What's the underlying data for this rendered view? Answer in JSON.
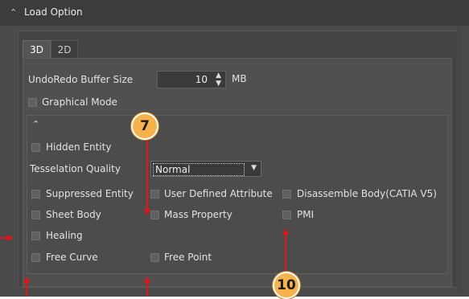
{
  "section": {
    "title": "Load Option"
  },
  "tabs": [
    {
      "label": "3D"
    },
    {
      "label": "2D"
    }
  ],
  "undo": {
    "label": "UndoRedo Buffer Size",
    "value": "10",
    "unit": "MB"
  },
  "graphical_mode": {
    "label": "Graphical Mode"
  },
  "advanced": {
    "hidden_entity": "Hidden Entity",
    "tesselation_label": "Tesselation Quality",
    "tesselation_value": "Normal",
    "suppressed_entity": "Suppressed Entity",
    "user_defined_attribute": "User Defined Attribute",
    "disassemble_body": "Disassemble Body(CATIA V5)",
    "sheet_body": "Sheet Body",
    "mass_property": "Mass Property",
    "pmi": "PMI",
    "healing": "Healing",
    "free_curve": "Free Curve",
    "free_point": "Free Point"
  },
  "callouts": [
    {
      "label": "7"
    },
    {
      "label": "10"
    }
  ],
  "colors": {
    "accent": "#e8121a",
    "badge": "#f7b24a",
    "panel": "#4a4a4a"
  }
}
